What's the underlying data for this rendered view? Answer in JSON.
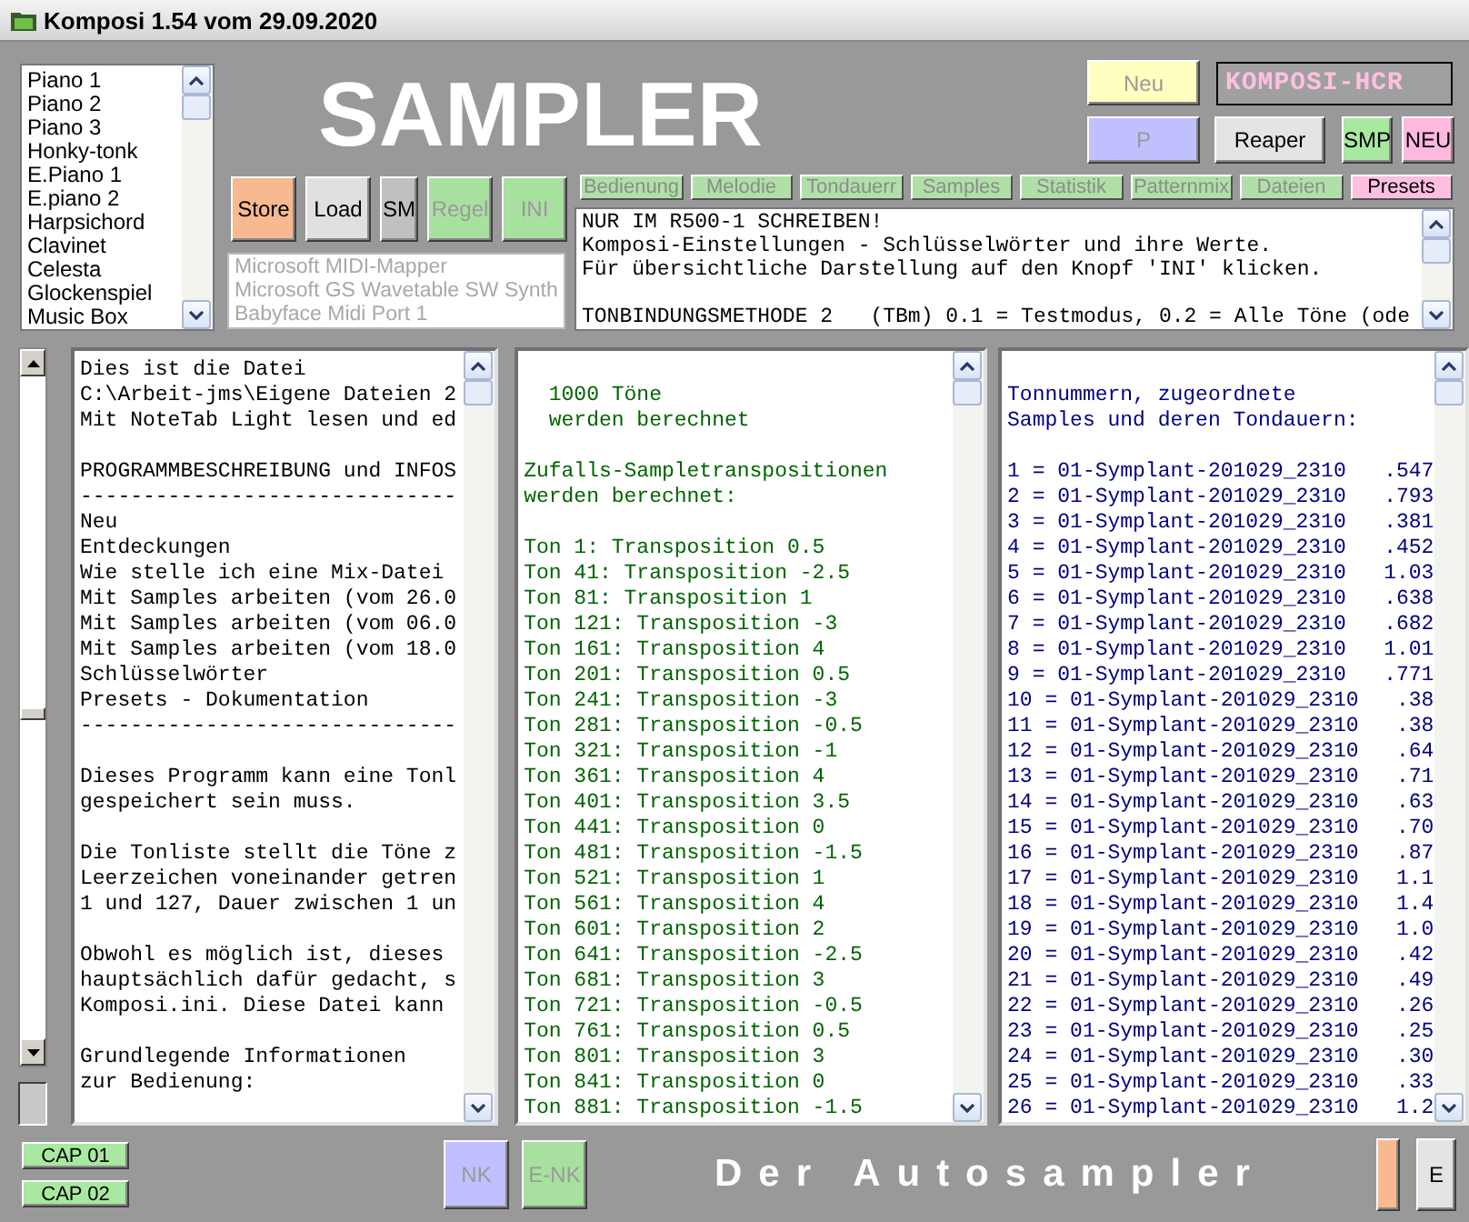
{
  "window": {
    "title": "Komposi 1.54 vom 29.09.2020"
  },
  "instruments": {
    "items": [
      "Piano 1",
      "Piano 2",
      "Piano 3",
      "Honky-tonk",
      "E.Piano 1",
      "E.piano 2",
      "Harpsichord",
      "Clavinet",
      "Celesta",
      "Glockenspiel",
      "Music Box"
    ]
  },
  "app_title": "SAMPLER",
  "action_buttons": [
    {
      "label": "Store",
      "color": "#f8b890",
      "disabled": false
    },
    {
      "label": "Load",
      "color": "#e0e0e0",
      "disabled": false
    },
    {
      "label": "SM",
      "color": "#c0c0c0",
      "disabled": false
    },
    {
      "label": "Regel",
      "color": "#a8e0a0",
      "disabled": true
    },
    {
      "label": "INI",
      "color": "#a8e0a0",
      "disabled": true
    }
  ],
  "midi_ports": {
    "disabled": true,
    "items": [
      "Microsoft MIDI-Mapper",
      "Microsoft GS Wavetable SW Synth",
      "Babyface Midi Port 1"
    ]
  },
  "top_right_buttons": [
    {
      "label": "Neu",
      "color": "#ffffc0",
      "disabled": true
    },
    {
      "label": "P",
      "color": "#c0c0ff",
      "disabled": true
    },
    {
      "label": "Reaper",
      "color": "#e4e4e4",
      "disabled": false
    },
    {
      "label": "SMP",
      "color": "#a8e8a0",
      "disabled": false
    },
    {
      "label": "NEU",
      "color": "#ffb8e0",
      "disabled": false
    }
  ],
  "project_field": {
    "value": "KOMPOSI-HCR"
  },
  "tabs": [
    {
      "label": "Bedienung",
      "selected": false
    },
    {
      "label": "Melodie",
      "selected": false
    },
    {
      "label": "Tondauerr",
      "selected": false
    },
    {
      "label": "Samples",
      "selected": false
    },
    {
      "label": "Statistik",
      "selected": false
    },
    {
      "label": "Patternmix",
      "selected": false
    },
    {
      "label": "Dateien",
      "selected": false
    },
    {
      "label": "Presets",
      "selected": true
    }
  ],
  "info_text": {
    "lines": [
      "NUR IM R500-1 SCHREIBEN!",
      "Komposi-Einstellungen - Schlüsselwörter und ihre Werte.",
      "Für übersichtliche Darstellung auf den Knopf 'INI' klicken.",
      "TONBINDUNGSMETHODE 2   (TBm) 0.1 = Testmodus, 0.2 = Alle Töne (ode"
    ]
  },
  "panels": [
    {
      "color": "#000000",
      "paragraphs": [
        [
          "Dies ist die Datei",
          "C:\\Arbeit-jms\\Eigene Dateien 2",
          "Mit NoteTab Light lesen und ed"
        ],
        [
          "PROGRAMMBESCHREIBUNG und INFOS",
          "------------------------------",
          "Neu",
          "Entdeckungen",
          "Wie stelle ich eine Mix-Datei",
          "Mit Samples arbeiten (vom 26.0",
          "Mit Samples arbeiten (vom 06.0",
          "Mit Samples arbeiten (vom 18.0",
          "Schlüsselwörter",
          "Presets - Dokumentation",
          "------------------------------"
        ],
        [
          "Dieses Programm kann eine Tonl",
          "gespeichert sein muss."
        ],
        [
          "Die Tonliste stellt die Töne z",
          "Leerzeichen voneinander getren",
          "1 und 127, Dauer zwischen 1 un"
        ],
        [
          "Obwohl es möglich ist, dieses",
          "hauptsächlich dafür gedacht, s",
          "Komposi.ini. Diese Datei kann"
        ],
        [
          "Grundlegende Informationen",
          "zur Bedienung:"
        ]
      ]
    },
    {
      "color": "#006400",
      "paragraphs": [
        [
          "  1000 Töne",
          "  werden berechnet"
        ],
        [
          "Zufalls-Sampletranspositionen",
          "werden berechnet:"
        ],
        [
          "Ton 1: Transposition 0.5",
          "Ton 41: Transposition -2.5",
          "Ton 81: Transposition 1",
          "Ton 121: Transposition -3",
          "Ton 161: Transposition 4",
          "Ton 201: Transposition 0.5",
          "Ton 241: Transposition -3",
          "Ton 281: Transposition -0.5",
          "Ton 321: Transposition -1",
          "Ton 361: Transposition 4",
          "Ton 401: Transposition 3.5",
          "Ton 441: Transposition 0",
          "Ton 481: Transposition -1.5",
          "Ton 521: Transposition 1",
          "Ton 561: Transposition 4",
          "Ton 601: Transposition 2",
          "Ton 641: Transposition -2.5",
          "Ton 681: Transposition 3",
          "Ton 721: Transposition -0.5",
          "Ton 761: Transposition 0.5",
          "Ton 801: Transposition 3",
          "Ton 841: Transposition 0",
          "Ton 881: Transposition -1.5"
        ]
      ]
    },
    {
      "color": "#000080",
      "paragraphs": [
        [
          "Tonnummern, zugeordnete",
          "Samples und deren Tondauern:"
        ],
        [
          "1 = 01-Symplant-201029_2310   .547",
          "2 = 01-Symplant-201029_2310   .793",
          "3 = 01-Symplant-201029_2310   .381",
          "4 = 01-Symplant-201029_2310   .452",
          "5 = 01-Symplant-201029_2310   1.03",
          "6 = 01-Symplant-201029_2310   .638",
          "7 = 01-Symplant-201029_2310   .682",
          "8 = 01-Symplant-201029_2310   1.01",
          "9 = 01-Symplant-201029_2310   .771",
          "10 = 01-Symplant-201029_2310   .38",
          "11 = 01-Symplant-201029_2310   .38",
          "12 = 01-Symplant-201029_2310   .64",
          "13 = 01-Symplant-201029_2310   .71",
          "14 = 01-Symplant-201029_2310   .63",
          "15 = 01-Symplant-201029_2310   .70",
          "16 = 01-Symplant-201029_2310   .87",
          "17 = 01-Symplant-201029_2310   1.1",
          "18 = 01-Symplant-201029_2310   1.4",
          "19 = 01-Symplant-201029_2310   1.0",
          "20 = 01-Symplant-201029_2310   .42",
          "21 = 01-Symplant-201029_2310   .49",
          "22 = 01-Symplant-201029_2310   .26",
          "23 = 01-Symplant-201029_2310   .25",
          "24 = 01-Symplant-201029_2310   .30",
          "25 = 01-Symplant-201029_2310   .33",
          "26 = 01-Symplant-201029_2310   1.2"
        ]
      ]
    }
  ],
  "bottom_left_buttons": [
    {
      "label": "CAP 01",
      "color": "#a8e8a0",
      "disabled": false
    },
    {
      "label": "CAP 02",
      "color": "#a8e8a0",
      "disabled": false
    }
  ],
  "bottom_center_buttons": [
    {
      "label": "NK",
      "color": "#c0c0ff",
      "disabled": true
    },
    {
      "label": "E-NK",
      "color": "#a8e0a0",
      "disabled": true
    }
  ],
  "footer_title": "Der Autosampler",
  "bottom_right_buttons": [
    {
      "color": "#f8b890"
    },
    {
      "label": "E",
      "color": "#e4e4e4",
      "disabled": false
    }
  ]
}
